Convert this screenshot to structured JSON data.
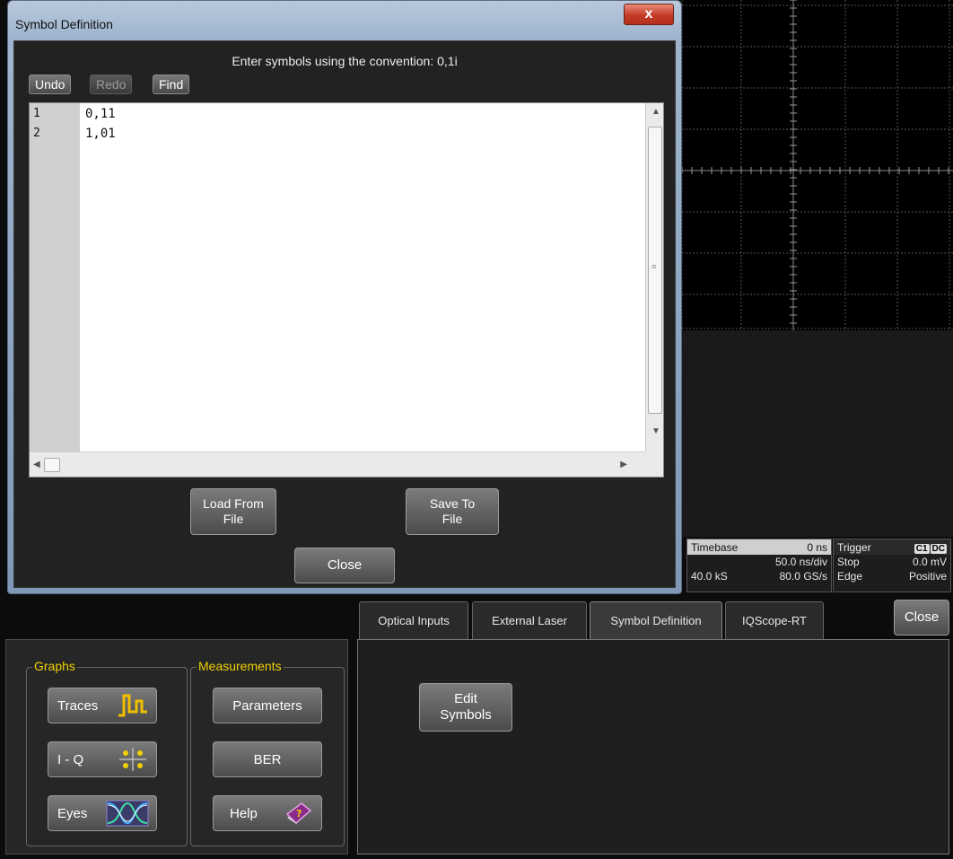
{
  "dialog": {
    "title": "Symbol Definition",
    "close_glyph": "x",
    "instruction": "Enter symbols using the convention: 0,1i",
    "toolbar": {
      "undo": "Undo",
      "redo": "Redo",
      "find": "Find"
    },
    "editor": {
      "lines": [
        {
          "number": "1",
          "text": "0,11"
        },
        {
          "number": "2",
          "text": "1,01"
        }
      ]
    },
    "load_from_file": {
      "line1": "Load From",
      "line2": "File"
    },
    "save_to_file": {
      "line1": "Save To",
      "line2": "File"
    },
    "close": "Close"
  },
  "status": {
    "timebase": {
      "label": "Timebase",
      "delay": "0 ns",
      "per_div": "50.0 ns/div",
      "samples": "40.0 kS",
      "rate": "80.0 GS/s"
    },
    "trigger": {
      "label": "Trigger",
      "badge1": "C1",
      "badge2": "DC",
      "mode": "Stop",
      "level": "0.0 mV",
      "type": "Edge",
      "slope": "Positive"
    }
  },
  "tabs": [
    "Optical Inputs",
    "External Laser",
    "Symbol Definition",
    "IQScope-RT"
  ],
  "active_tab": "Symbol Definition",
  "main_close": "Close",
  "graphs": {
    "label": "Graphs",
    "traces": "Traces",
    "iq": "I - Q",
    "eyes": "Eyes"
  },
  "measurements": {
    "label": "Measurements",
    "parameters": "Parameters",
    "ber": "BER",
    "help": "Help"
  },
  "edit_symbols": {
    "line1": "Edit",
    "line2": "Symbols"
  },
  "colors": {
    "accent_yellow": "#f0d000",
    "dialog_close_red": "#c43b26"
  }
}
